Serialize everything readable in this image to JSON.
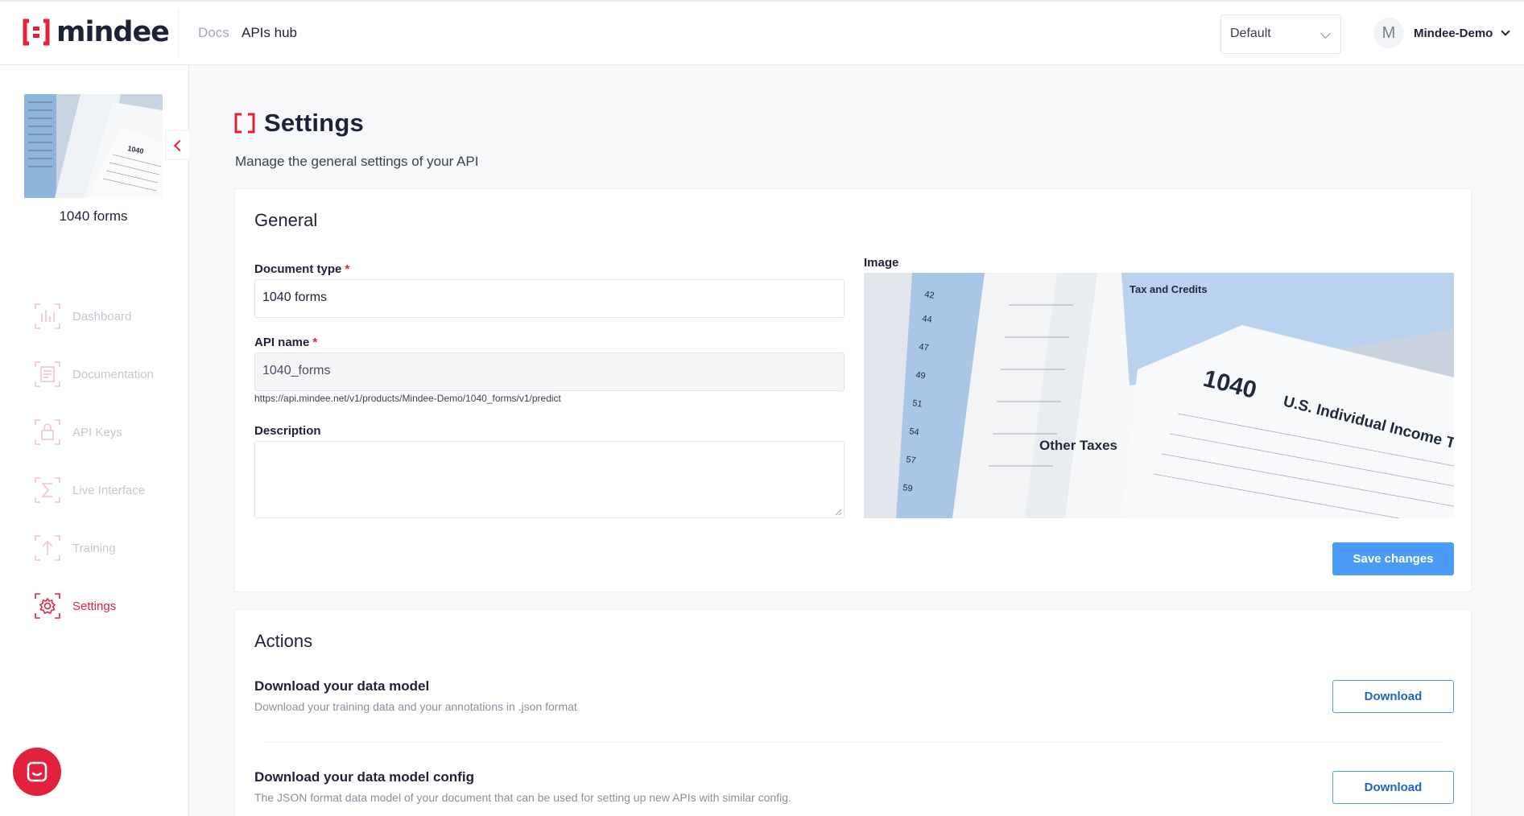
{
  "brand": {
    "name": "mindee",
    "accent": "#e2223c",
    "primary_button": "#4a9bf5"
  },
  "topnav": {
    "docs": "Docs",
    "apis_hub": "APIs hub"
  },
  "environment": {
    "selected": "Default"
  },
  "user": {
    "initial": "M",
    "name": "Mindee-Demo"
  },
  "sidebar": {
    "api_title": "1040 forms",
    "items": [
      {
        "label": "Dashboard",
        "icon": "chart-icon"
      },
      {
        "label": "Documentation",
        "icon": "document-icon"
      },
      {
        "label": "API Keys",
        "icon": "lock-icon"
      },
      {
        "label": "Live Interface",
        "icon": "sigma-icon"
      },
      {
        "label": "Training",
        "icon": "upload-icon"
      },
      {
        "label": "Settings",
        "icon": "gear-icon",
        "active": true
      }
    ]
  },
  "page": {
    "title": "Settings",
    "subtitle": "Manage the general settings of your API"
  },
  "general": {
    "heading": "General",
    "document_type_label": "Document type",
    "document_type_value": "1040 forms",
    "required_mark": "*",
    "api_name_label": "API name",
    "api_name_value": "1040_forms",
    "api_url": "https://api.mindee.net/v1/products/Mindee-Demo/1040_forms/v1/predict",
    "description_label": "Description",
    "description_value": "",
    "image_label": "Image",
    "save_label": "Save changes"
  },
  "actions": {
    "heading": "Actions",
    "items": [
      {
        "title": "Download your data model",
        "description": "Download your training data and your annotations in .json format",
        "button": "Download"
      },
      {
        "title": "Download your data model config",
        "description": "The JSON format data model of your document that can be used for setting up new APIs with similar config.",
        "button": "Download"
      }
    ]
  },
  "form_image": {
    "form_number": "1040",
    "form_title": "U.S. Individual Income Tax",
    "tax_credits": "Tax and Credits",
    "other_taxes": "Other Taxes"
  }
}
